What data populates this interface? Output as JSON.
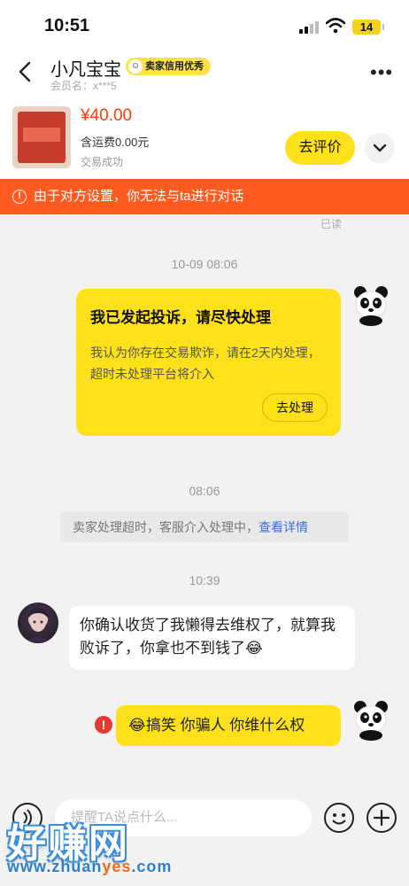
{
  "status_bar": {
    "time": "10:51",
    "battery": "14"
  },
  "header": {
    "seller_name": "小凡宝宝",
    "credit_badge": "卖家信用优秀",
    "member_id": "会员名：x***5"
  },
  "product": {
    "price": "¥40.00",
    "shipping": "含运费0.00元",
    "status": "交易成功",
    "review_button": "去评价"
  },
  "notice": {
    "text": "由于对方设置，你无法与ta进行对话",
    "icon": "!"
  },
  "chat": {
    "read_label": "已读",
    "timestamp_1": "10-09 08:06",
    "complaint": {
      "title": "我已发起投诉，请尽快处理",
      "body": "我认为你存在交易欺诈，请在2天内处理，超时未处理平台将介入",
      "button": "去处理"
    },
    "timestamp_2": "08:06",
    "system_msg": {
      "text": "卖家处理超时，客服介入处理中，",
      "link": "查看详情"
    },
    "timestamp_3": "10:39",
    "buyer_message": "你确认收货了我懒得去维权了，就算我败诉了，你拿也不到钱了😂",
    "my_message": "😂搞笑 你骗人 你维什么权",
    "error_icon": "!"
  },
  "input": {
    "placeholder": "提醒TA说点什么..."
  },
  "watermark": {
    "main": "好赚网",
    "url_part1": "www.zhuan",
    "url_accent": "yes",
    "url_part2": ".com"
  },
  "colors": {
    "brand_yellow": "#ffe11b",
    "notice_orange": "#ff5a1f",
    "price_red": "#ff3c00",
    "link_blue": "#3a6ed8"
  },
  "icons": [
    "back-arrow-icon",
    "more-icon",
    "chevron-down-icon",
    "alert-circle-icon",
    "panda-avatar-icon",
    "error-icon",
    "voice-icon",
    "emoji-icon",
    "plus-icon"
  ]
}
